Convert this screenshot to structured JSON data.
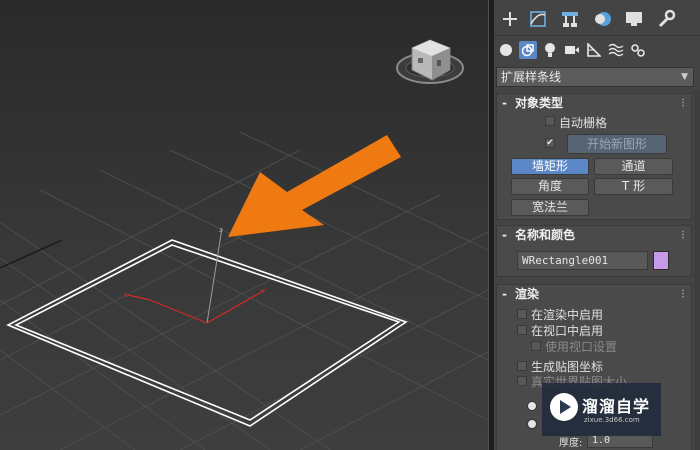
{
  "panel": {
    "tabs": [
      {
        "name": "create-tab",
        "icon": "plus-icon"
      },
      {
        "name": "modify-tab",
        "icon": "modify-icon"
      },
      {
        "name": "hierarchy-tab",
        "icon": "hierarchy-icon"
      },
      {
        "name": "motion-tab",
        "icon": "motion-icon"
      },
      {
        "name": "display-tab",
        "icon": "display-icon"
      },
      {
        "name": "utilities-tab",
        "icon": "wrench-icon"
      }
    ],
    "subcategories": [
      {
        "name": "geometry-icon"
      },
      {
        "name": "shapes-icon"
      },
      {
        "name": "lights-icon"
      },
      {
        "name": "cameras-icon"
      },
      {
        "name": "helpers-icon"
      },
      {
        "name": "spacewarps-icon"
      },
      {
        "name": "systems-icon"
      }
    ],
    "category_dropdown": "扩展样条线",
    "object_type": {
      "title": "对象类型",
      "auto_grid_label": "自动栅格",
      "auto_grid_checked": false,
      "start_new_shape_checked": true,
      "start_new_shape_label": "开始新图形",
      "buttons": [
        "墙矩形",
        "通道",
        "角度",
        "T 形",
        "宽法兰"
      ],
      "active_button": "墙矩形"
    },
    "name_color": {
      "title": "名称和颜色",
      "name_value": "WRectangle001",
      "color": "#c79ae8"
    },
    "render": {
      "title": "渲染",
      "enable_in_renderer": "在渲染中启用",
      "enable_in_viewport": "在视口中启用",
      "use_viewport_settings": "使用视口设置",
      "generate_mapping": "生成贴图坐标",
      "real_world_map_size": "真实世界贴图大小",
      "thickness_label": "厚度:",
      "thickness_value": "1.0"
    }
  },
  "watermark": {
    "title": "溜溜自学",
    "url": "zixue.3d66.com"
  },
  "colors": {
    "accent_active": "#5b87c6",
    "arrow": "#f07a12",
    "object_color": "#c79ae8"
  }
}
